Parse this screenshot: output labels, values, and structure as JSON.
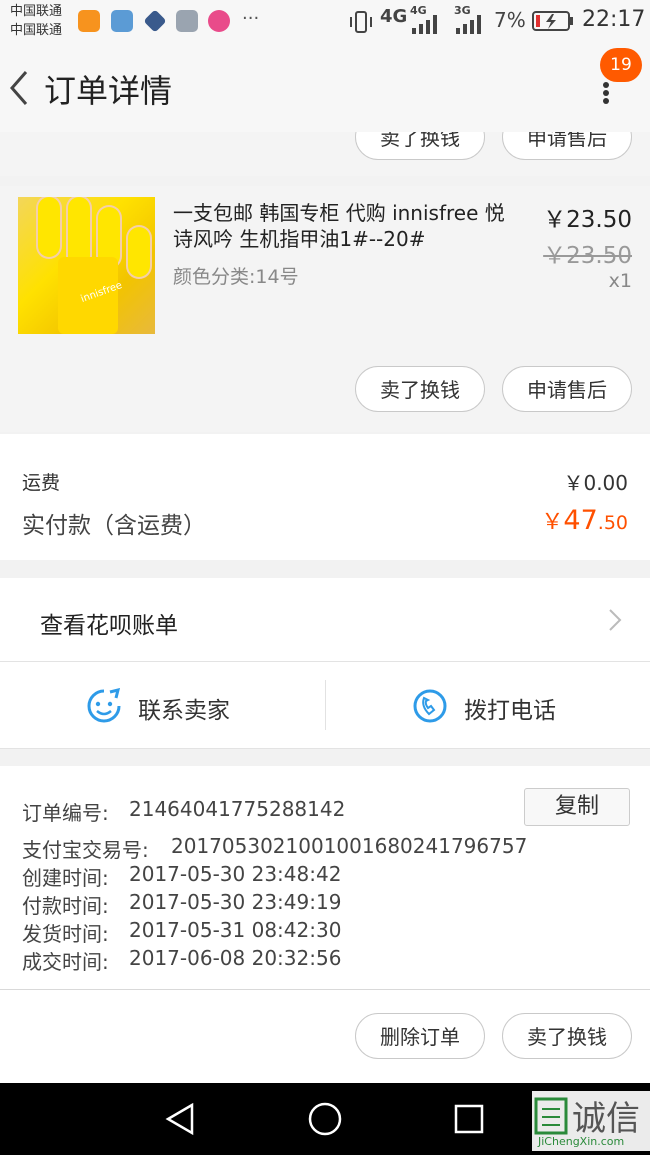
{
  "status_bar": {
    "carrier_1": "中国联通",
    "carrier_2": "中国联通",
    "network_1": "4G",
    "network_2": "4G",
    "network_3": "3G",
    "battery": "7%",
    "time": "22:17",
    "more": "···"
  },
  "header": {
    "title": "订单详情",
    "badge_count": "19"
  },
  "prev_item": {
    "button_exchange": "卖了换钱",
    "button_aftersale": "申请售后"
  },
  "item": {
    "title": "一支包邮 韩国专柜 代购 innisfree 悦诗风吟 生机指甲油1#--20#",
    "variant": "颜色分类:14号",
    "price": "￥23.50",
    "original_price": "￥23.50",
    "quantity": "x1",
    "button_exchange": "卖了换钱",
    "button_aftersale": "申请售后",
    "image_text": "innisfree"
  },
  "summary": {
    "shipping_label": "运费",
    "shipping_value": "￥0.00",
    "paid_label": "实付款（含运费）",
    "paid_currency": "￥",
    "paid_int": "47",
    "paid_dec": ".50"
  },
  "huabei": {
    "label": "查看花呗账单"
  },
  "contact": {
    "seller": "联系卖家",
    "call": "拨打电话"
  },
  "order_info": {
    "order_no_label": "订单编号:",
    "order_no": "21464041775288142",
    "copy_button": "复制",
    "alipay_label": "支付宝交易号:",
    "alipay_no": "2017053021001001680241796757",
    "created_label": "创建时间:",
    "created": "2017-05-30 23:48:42",
    "paid_label": "付款时间:",
    "paid": "2017-05-30 23:49:19",
    "shipped_label": "发货时间:",
    "shipped": "2017-05-31 08:42:30",
    "done_label": "成交时间:",
    "done": "2017-06-08 20:32:56"
  },
  "bottom_actions": {
    "delete": "删除订单",
    "exchange": "卖了换钱"
  },
  "watermark": {
    "brand": "诚信",
    "url": "JiChengXin.com"
  },
  "colors": {
    "accent_orange": "#ff5000",
    "badge": "#ff5a00",
    "contact_blue": "#2e9be8"
  }
}
